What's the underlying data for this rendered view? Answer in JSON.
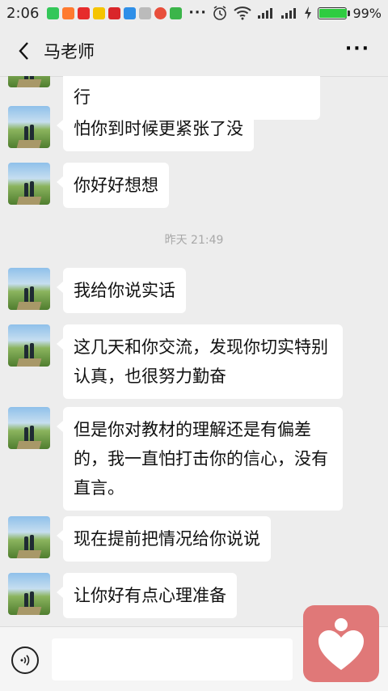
{
  "status_bar": {
    "time": "2:06",
    "battery": "99%",
    "battery_level": 0.99
  },
  "header": {
    "title": "马老师"
  },
  "messages": [
    {
      "text": "…方天返行…乙已介女…些应行"
    },
    {
      "text": "怕你到时候更紧张了没"
    },
    {
      "text": "你好好想想"
    },
    {
      "text": "我给你说实话"
    },
    {
      "text": "这几天和你交流，发现你切实特别认真，也很努力勤奋"
    },
    {
      "text": "但是你对教材的理解还是有偏差的，我一直怕打击你的信心，没有直言。"
    },
    {
      "text": "现在提前把情况给你说说"
    },
    {
      "text": "让你好有点心理准备"
    }
  ],
  "timestamp": "昨天 21:49",
  "icons": {
    "back": "chevron-left-icon",
    "more": "more-dots-icon",
    "voice": "voice-icon",
    "float": "heart-person-icon"
  },
  "colors": {
    "background": "#ededed",
    "bubble": "#ffffff",
    "float_button": "#e07878",
    "battery": "#2ecc40"
  }
}
